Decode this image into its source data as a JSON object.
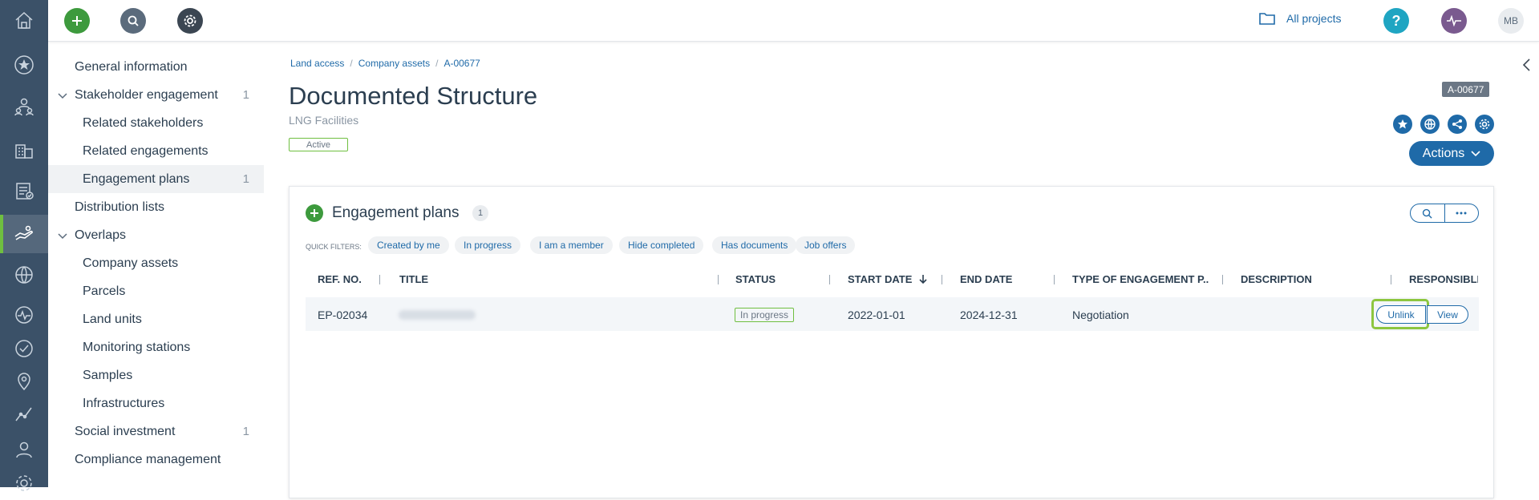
{
  "topbar": {
    "all_projects": "All projects",
    "avatar_initials": "MB",
    "icons": [
      "add-icon",
      "search-icon",
      "gear-icon",
      "folder-icon",
      "help-icon",
      "activity-icon"
    ]
  },
  "rail": {
    "icons": [
      "home-icon",
      "star-icon",
      "stakeholders-icon",
      "buildings-icon",
      "checklist-icon",
      "hand-icon",
      "globe-icon",
      "pulse-icon",
      "check-circle-icon",
      "location-icon",
      "chart-icon",
      "user-icon",
      "settings-icon"
    ]
  },
  "sidenav": {
    "items": [
      {
        "label": "General information",
        "count": ""
      },
      {
        "label": "Stakeholder engagement",
        "count": "1"
      },
      {
        "label": "Related stakeholders",
        "count": ""
      },
      {
        "label": "Related engagements",
        "count": ""
      },
      {
        "label": "Engagement plans",
        "count": "1"
      },
      {
        "label": "Distribution lists",
        "count": ""
      },
      {
        "label": "Overlaps",
        "count": ""
      },
      {
        "label": "Company assets",
        "count": ""
      },
      {
        "label": "Parcels",
        "count": ""
      },
      {
        "label": "Land units",
        "count": ""
      },
      {
        "label": "Monitoring stations",
        "count": ""
      },
      {
        "label": "Samples",
        "count": ""
      },
      {
        "label": "Infrastructures",
        "count": ""
      },
      {
        "label": "Social investment",
        "count": "1"
      },
      {
        "label": "Compliance management",
        "count": ""
      }
    ]
  },
  "breadcrumb": [
    "Land access",
    "Company assets",
    "A-00677"
  ],
  "header": {
    "title": "Documented Structure",
    "subtitle": "LNG Facilities",
    "status": "Active",
    "id_tag": "A-00677",
    "actions_label": "Actions"
  },
  "card": {
    "title": "Engagement plans",
    "count": "1",
    "quick_filters_label": "QUICK FILTERS:",
    "quick_filters": [
      "Created by me",
      "In progress",
      "I am a member",
      "Hide completed",
      "Has documents",
      "Job offers"
    ],
    "columns": [
      "REF. NO.",
      "TITLE",
      "STATUS",
      "START DATE",
      "END DATE",
      "TYPE OF ENGAGEMENT P...",
      "DESCRIPTION",
      "RESPONSIBLE"
    ],
    "rows": [
      {
        "ref_no": "EP-02034",
        "status": "In progress",
        "start_date": "2022-01-01",
        "end_date": "2024-12-31",
        "type": "Negotiation",
        "description": ""
      }
    ],
    "row_actions": {
      "unlink": "Unlink",
      "view": "View"
    }
  },
  "colors": {
    "rail_bg": "#3b5168",
    "primary": "#1f6aa8",
    "green": "#3d9a3d",
    "highlight": "#8dc63f"
  }
}
